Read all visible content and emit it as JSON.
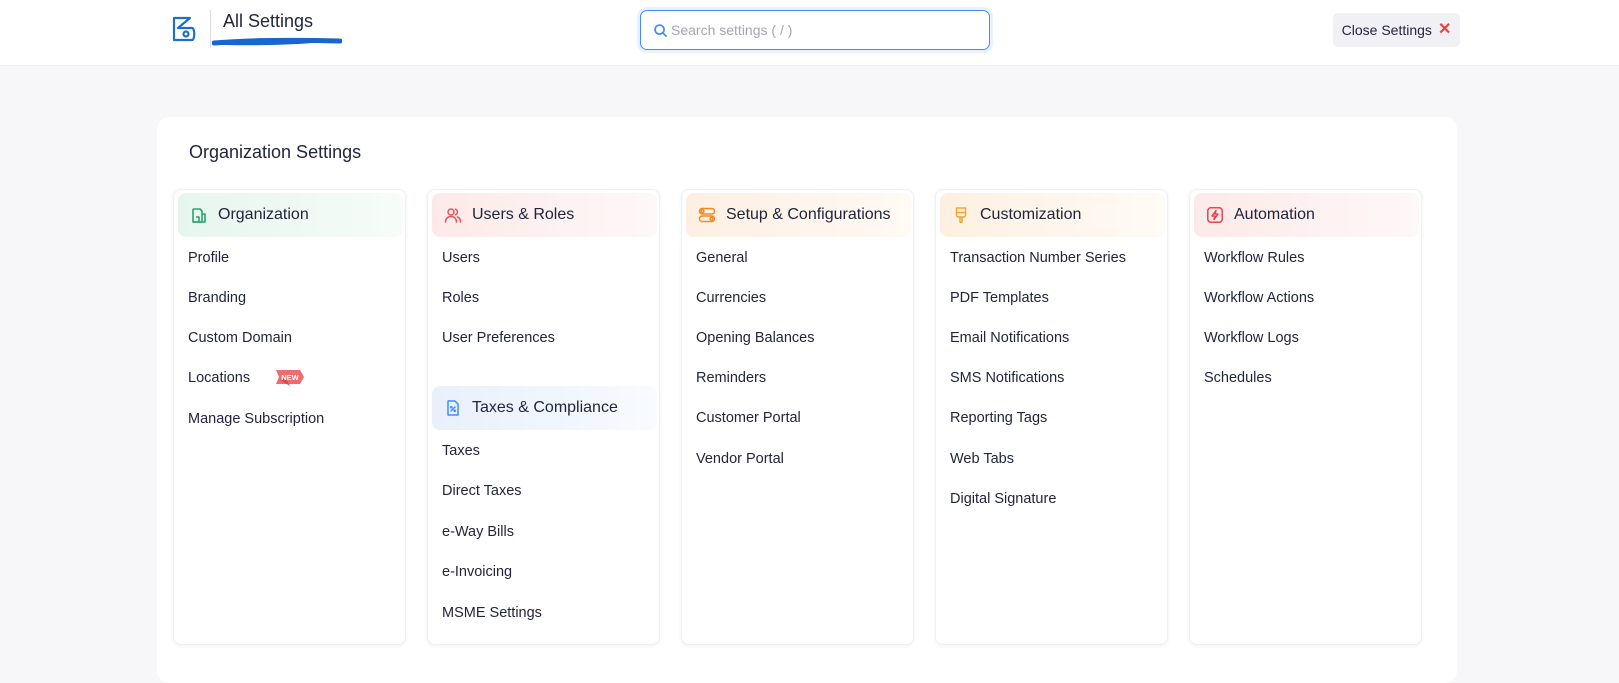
{
  "header": {
    "title": "All Settings",
    "search_placeholder": "Search settings ( / )",
    "search_value": "",
    "close_label": "Close Settings"
  },
  "main": {
    "section_title": "Organization Settings",
    "columns": [
      {
        "groups": [
          {
            "title": "Organization",
            "icon": "building-icon",
            "accent": "#2aa36f",
            "items": [
              "Profile",
              "Branding",
              "Custom Domain",
              "Locations",
              "Manage Subscription"
            ],
            "badge": {
              "item": "Locations",
              "label": "NEW"
            }
          }
        ]
      },
      {
        "groups": [
          {
            "title": "Users & Roles",
            "icon": "users-icon",
            "accent": "#e8545b",
            "items": [
              "Users",
              "Roles",
              "User Preferences"
            ]
          },
          {
            "title": "Taxes & Compliance",
            "icon": "tax-document-icon",
            "accent": "#408dfb",
            "items": [
              "Taxes",
              "Direct Taxes",
              "e-Way Bills",
              "e-Invoicing",
              "MSME Settings"
            ]
          }
        ]
      },
      {
        "groups": [
          {
            "title": "Setup & Configurations",
            "icon": "config-toggles-icon",
            "accent": "#f08a24",
            "items": [
              "General",
              "Currencies",
              "Opening Balances",
              "Reminders",
              "Customer Portal",
              "Vendor Portal"
            ]
          }
        ]
      },
      {
        "groups": [
          {
            "title": "Customization",
            "icon": "brush-icon",
            "accent": "#f0a43a",
            "items": [
              "Transaction Number Series",
              "PDF Templates",
              "Email Notifications",
              "SMS Notifications",
              "Reporting Tags",
              "Web Tabs",
              "Digital Signature"
            ]
          }
        ]
      },
      {
        "groups": [
          {
            "title": "Automation",
            "icon": "lightning-icon",
            "accent": "#e8454b",
            "items": [
              "Workflow Rules",
              "Workflow Actions",
              "Workflow Logs",
              "Schedules"
            ]
          }
        ]
      }
    ]
  },
  "colors": {
    "primary": "#408dfb",
    "close_x": "#f0403f",
    "logo": "#1f6fc5",
    "text": "#21263c"
  }
}
